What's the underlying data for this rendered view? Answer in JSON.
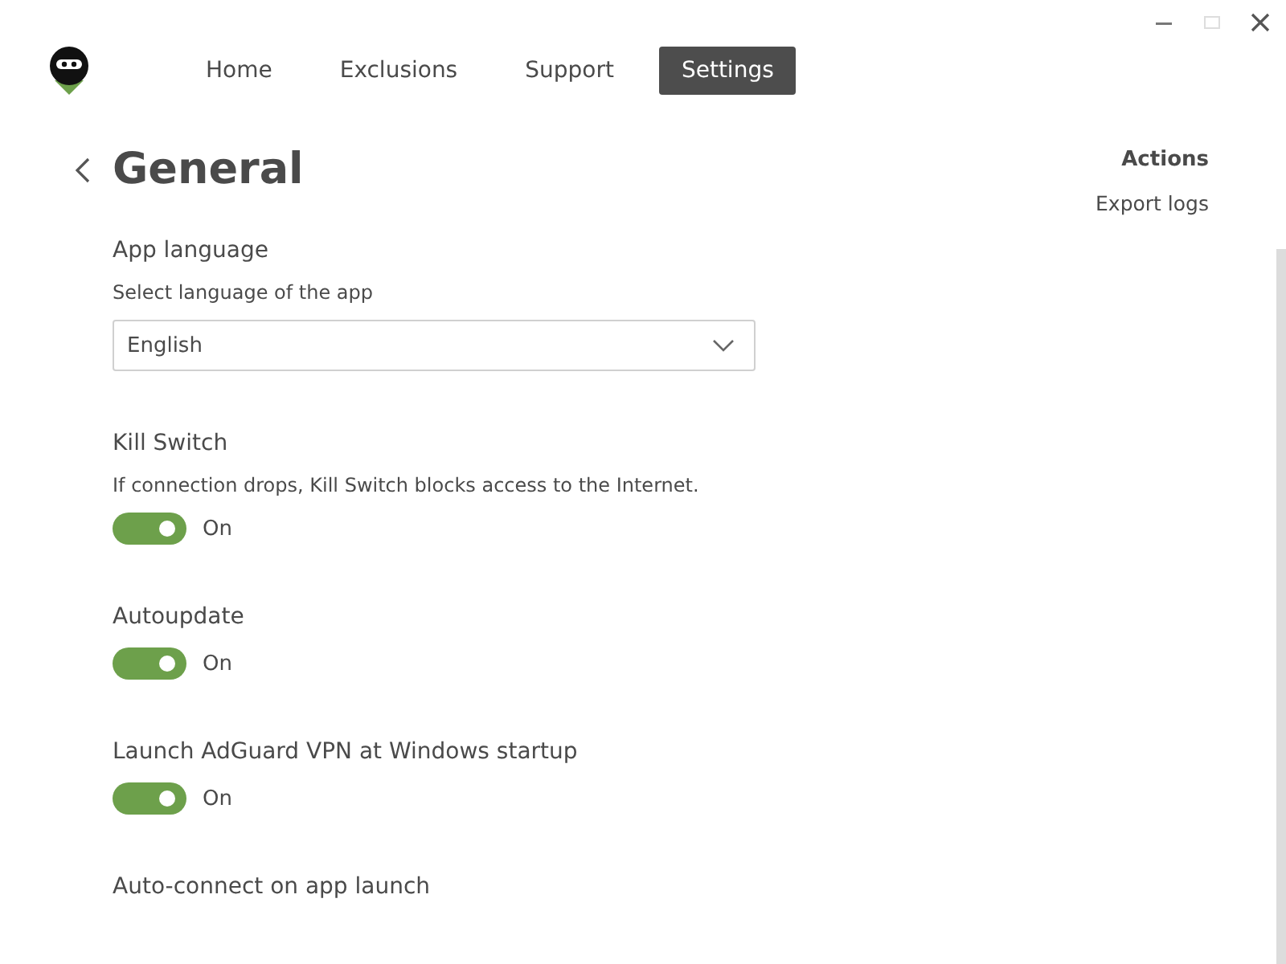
{
  "nav": [
    {
      "label": "Home",
      "selected": false
    },
    {
      "label": "Exclusions",
      "selected": false
    },
    {
      "label": "Support",
      "selected": false
    },
    {
      "label": "Settings",
      "selected": true
    }
  ],
  "page": {
    "title": "General"
  },
  "actions": {
    "title": "Actions",
    "items": [
      "Export logs"
    ]
  },
  "settings": [
    {
      "kind": "select",
      "title": "App language",
      "description": "Select language of the app",
      "value": "English"
    },
    {
      "kind": "toggle",
      "title": "Kill Switch",
      "description": "If connection drops, Kill Switch blocks access to the Internet.",
      "on": true,
      "state_label": "On"
    },
    {
      "kind": "toggle",
      "title": "Autoupdate",
      "on": true,
      "state_label": "On"
    },
    {
      "kind": "toggle",
      "title": "Launch AdGuard VPN at Windows startup",
      "on": true,
      "state_label": "On"
    },
    {
      "kind": "heading",
      "title": "Auto-connect on app launch"
    }
  ]
}
